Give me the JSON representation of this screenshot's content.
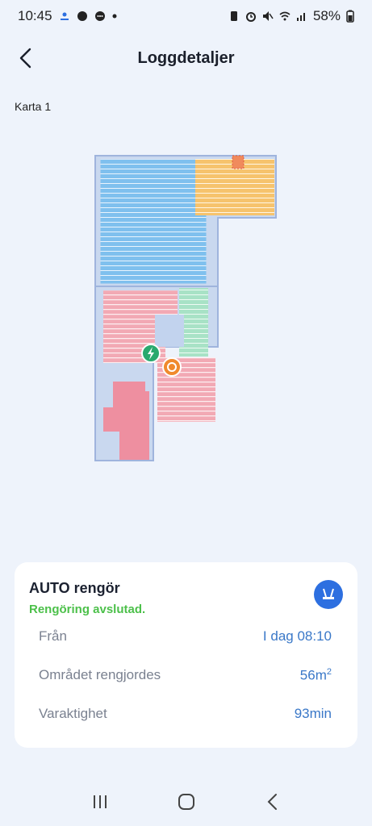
{
  "status_bar": {
    "time": "10:45",
    "battery": "58%",
    "left_icons": [
      "location-icon",
      "settings-icon",
      "chat-icon",
      "dot-icon"
    ],
    "right_icons": [
      "battery-saver-icon",
      "alarm-icon",
      "mute-icon",
      "wifi-icon",
      "signal-icon",
      "battery-icon"
    ]
  },
  "header": {
    "title": "Loggdetaljer",
    "back_icon": "chevron-left-icon"
  },
  "map": {
    "label": "Karta 1",
    "markers": [
      "charging-dock-icon",
      "robot-position-icon"
    ]
  },
  "card": {
    "title": "AUTO rengör",
    "status": "Rengöring avslutad.",
    "mode_icon": "mop-brushes-icon",
    "rows": [
      {
        "label": "Från",
        "value": "I dag 08:10"
      },
      {
        "label": "Området rengjordes",
        "value": "56m",
        "sup": "2"
      },
      {
        "label": "Varaktighet",
        "value": "93min"
      }
    ]
  },
  "colors": {
    "background": "#eef3fb",
    "accent_blue": "#2d6fe0",
    "success_green": "#4cc04a",
    "value_blue": "#3a78c8",
    "room_blue": "#7fc0ee",
    "room_orange": "#f6c36d",
    "room_pink": "#f2a9b4",
    "room_green": "#a8e2c6"
  },
  "nav": {
    "icons": [
      "recent-apps-icon",
      "home-icon",
      "back-icon"
    ]
  }
}
